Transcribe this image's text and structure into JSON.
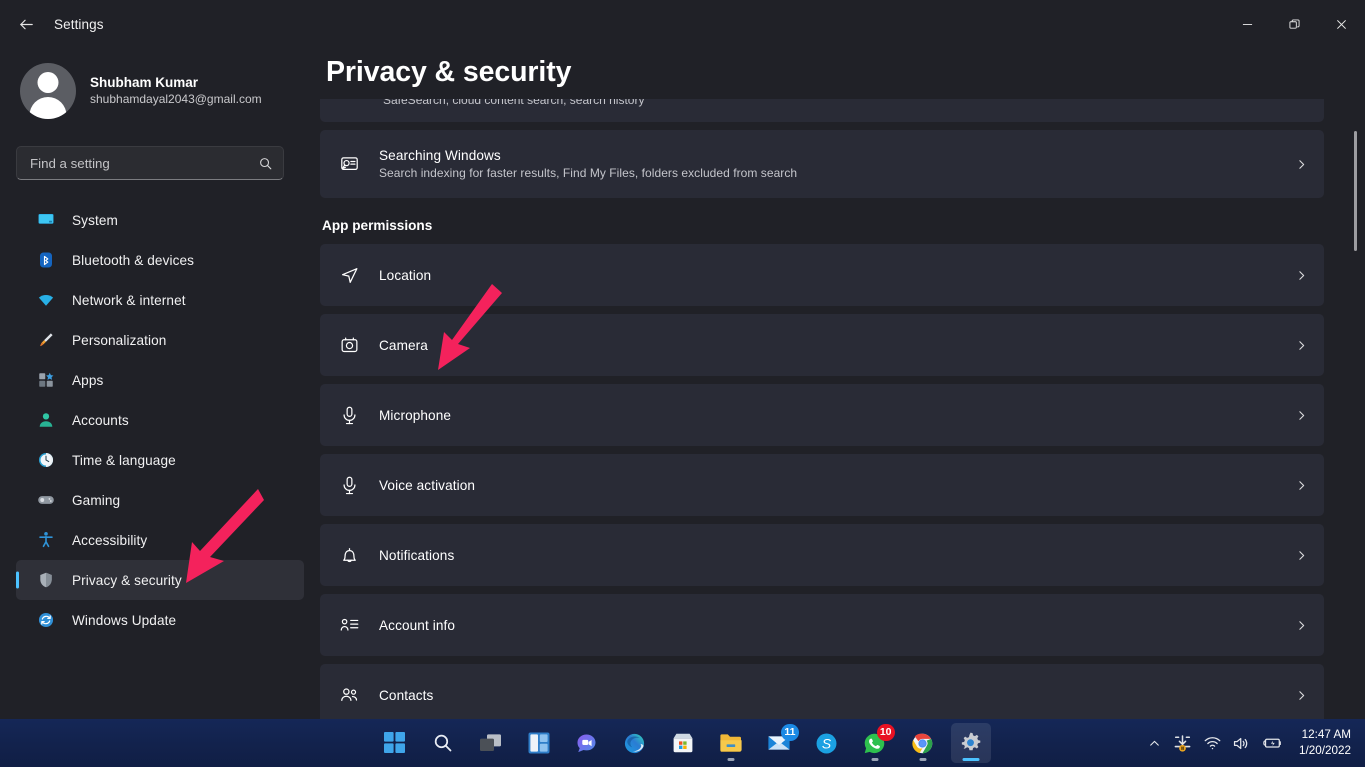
{
  "window": {
    "title": "Settings",
    "back_icon": "back-arrow-icon",
    "minimize_label": "Minimize",
    "maximize_label": "Restore",
    "close_label": "Close"
  },
  "profile": {
    "name": "Shubham Kumar",
    "email": "shubhamdayal2043@gmail.com",
    "avatar_icon": "user-avatar-icon"
  },
  "search": {
    "placeholder": "Find a setting",
    "value": "",
    "icon": "search-icon"
  },
  "sidebar": {
    "items": [
      {
        "label": "System",
        "icon": "system-icon",
        "selected": false
      },
      {
        "label": "Bluetooth & devices",
        "icon": "bluetooth-icon",
        "selected": false
      },
      {
        "label": "Network & internet",
        "icon": "wifi-icon",
        "selected": false
      },
      {
        "label": "Personalization",
        "icon": "paintbrush-icon",
        "selected": false
      },
      {
        "label": "Apps",
        "icon": "apps-icon",
        "selected": false
      },
      {
        "label": "Accounts",
        "icon": "account-icon",
        "selected": false
      },
      {
        "label": "Time & language",
        "icon": "clock-icon",
        "selected": false
      },
      {
        "label": "Gaming",
        "icon": "gamepad-icon",
        "selected": false
      },
      {
        "label": "Accessibility",
        "icon": "accessibility-icon",
        "selected": false
      },
      {
        "label": "Privacy & security",
        "icon": "shield-icon",
        "selected": true
      },
      {
        "label": "Windows Update",
        "icon": "update-icon",
        "selected": false
      }
    ]
  },
  "main": {
    "page_title": "Privacy & security",
    "clipped_card": {
      "subtitle": "SafeSearch, cloud content search, search history"
    },
    "search_permissions": {
      "title": "Searching Windows",
      "subtitle": "Search indexing for faster results, Find My Files, folders excluded from search",
      "icon": "search-windows-icon",
      "chevron": "chevron-right-icon"
    },
    "section_title": "App permissions",
    "permissions": [
      {
        "label": "Location",
        "icon": "location-icon",
        "chevron": "chevron-right-icon"
      },
      {
        "label": "Camera",
        "icon": "camera-icon",
        "chevron": "chevron-right-icon"
      },
      {
        "label": "Microphone",
        "icon": "microphone-icon",
        "chevron": "chevron-right-icon"
      },
      {
        "label": "Voice activation",
        "icon": "voice-activation-icon",
        "chevron": "chevron-right-icon"
      },
      {
        "label": "Notifications",
        "icon": "bell-icon",
        "chevron": "chevron-right-icon"
      },
      {
        "label": "Account info",
        "icon": "account-info-icon",
        "chevron": "chevron-right-icon"
      },
      {
        "label": "Contacts",
        "icon": "contacts-icon",
        "chevron": "chevron-right-icon"
      }
    ]
  },
  "annotations": {
    "color": "#f4225c",
    "arrows": [
      {
        "name": "arrow-pointing-to-camera",
        "target": "Camera"
      },
      {
        "name": "arrow-pointing-to-privacy-security",
        "target": "Privacy & security"
      }
    ]
  },
  "taskbar": {
    "items": [
      {
        "name": "start-button",
        "icon": "windows-start-icon",
        "badge": null,
        "active": false,
        "running": false
      },
      {
        "name": "search-button",
        "icon": "taskbar-search-icon",
        "badge": null,
        "active": false,
        "running": false
      },
      {
        "name": "task-view-button",
        "icon": "task-view-icon",
        "badge": null,
        "active": false,
        "running": false
      },
      {
        "name": "widgets-button",
        "icon": "widgets-icon",
        "badge": null,
        "active": false,
        "running": false
      },
      {
        "name": "chat-button",
        "icon": "chat-teams-icon",
        "badge": null,
        "active": false,
        "running": false
      },
      {
        "name": "edge-button",
        "icon": "microsoft-edge-icon",
        "badge": null,
        "active": false,
        "running": false
      },
      {
        "name": "store-button",
        "icon": "microsoft-store-icon",
        "badge": null,
        "active": false,
        "running": false
      },
      {
        "name": "file-explorer-button",
        "icon": "file-explorer-icon",
        "badge": null,
        "active": false,
        "running": true
      },
      {
        "name": "mail-button",
        "icon": "mail-icon",
        "badge": "11",
        "badge_color": "blue",
        "active": false,
        "running": false
      },
      {
        "name": "skype-button",
        "icon": "skype-icon",
        "badge": null,
        "active": false,
        "running": false
      },
      {
        "name": "whatsapp-button",
        "icon": "whatsapp-icon",
        "badge": "10",
        "badge_color": "red",
        "active": false,
        "running": true
      },
      {
        "name": "chrome-button",
        "icon": "google-chrome-icon",
        "badge": null,
        "active": false,
        "running": true
      },
      {
        "name": "settings-button",
        "icon": "settings-gear-icon",
        "badge": null,
        "active": true,
        "running": true
      }
    ],
    "tray": {
      "show_hidden_icons": "chevron-up-icon",
      "onedrive": "onedrive-sync-icon",
      "network": "wifi-icon",
      "volume": "speaker-icon",
      "battery": "battery-charging-icon",
      "time": "12:47 AM",
      "date": "1/20/2022"
    }
  }
}
